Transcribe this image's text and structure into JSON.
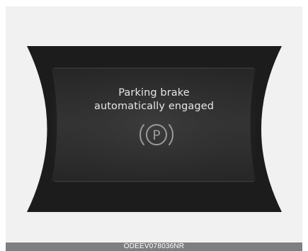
{
  "display": {
    "message_line1": "Parking brake",
    "message_line2": "automatically engaged",
    "indicator_icon": "parking-brake-icon",
    "indicator_letter": "P"
  },
  "caption": {
    "code": "ODEEV078036NR"
  },
  "colors": {
    "background": "#f1f1f1",
    "panel": "#1c1c1c",
    "screen": "#2e2e2e",
    "text": "#e6e6e6",
    "icon": "#9a9a9a",
    "caption_bar": "#7f7f7f"
  }
}
